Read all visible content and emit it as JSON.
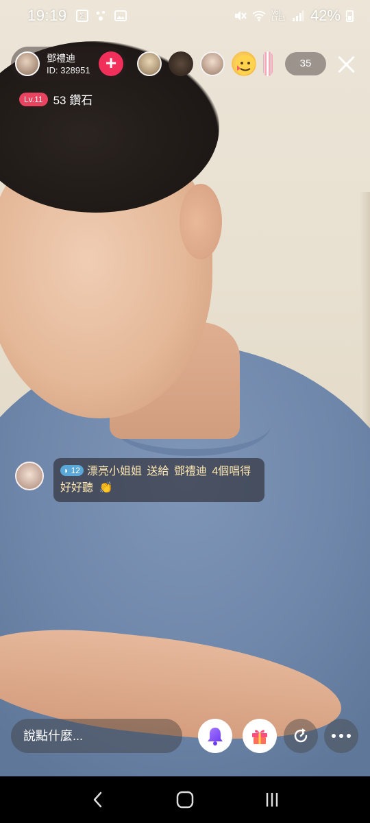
{
  "status_bar": {
    "time": "19:19",
    "battery": "42%",
    "lte_label_top": "Vo)",
    "lte_label_bottom": "LTE1"
  },
  "host": {
    "name": "鄧禮迪",
    "id": "ID: 328951",
    "follow_label": "+",
    "level": "Lv.11",
    "diamonds": "53 鑽石"
  },
  "viewers": {
    "count": "35",
    "avatars": [
      "viewer-avatar-1",
      "viewer-avatar-2",
      "viewer-avatar-3",
      "viewer-avatar-4",
      "viewer-avatar-5"
    ]
  },
  "gift_message": {
    "user_level": "12",
    "sender": "漂亮小姐姐",
    "verb": "送給",
    "target": "鄧禮迪",
    "item": "4個唱得好好聽",
    "emoji": "👏"
  },
  "chat": {
    "placeholder": "說點什麼..."
  },
  "colors": {
    "follow": "#f0305a",
    "level_badge": "#e8435f",
    "bell": "#8b5cf6",
    "gift": "#ff4d7d"
  }
}
